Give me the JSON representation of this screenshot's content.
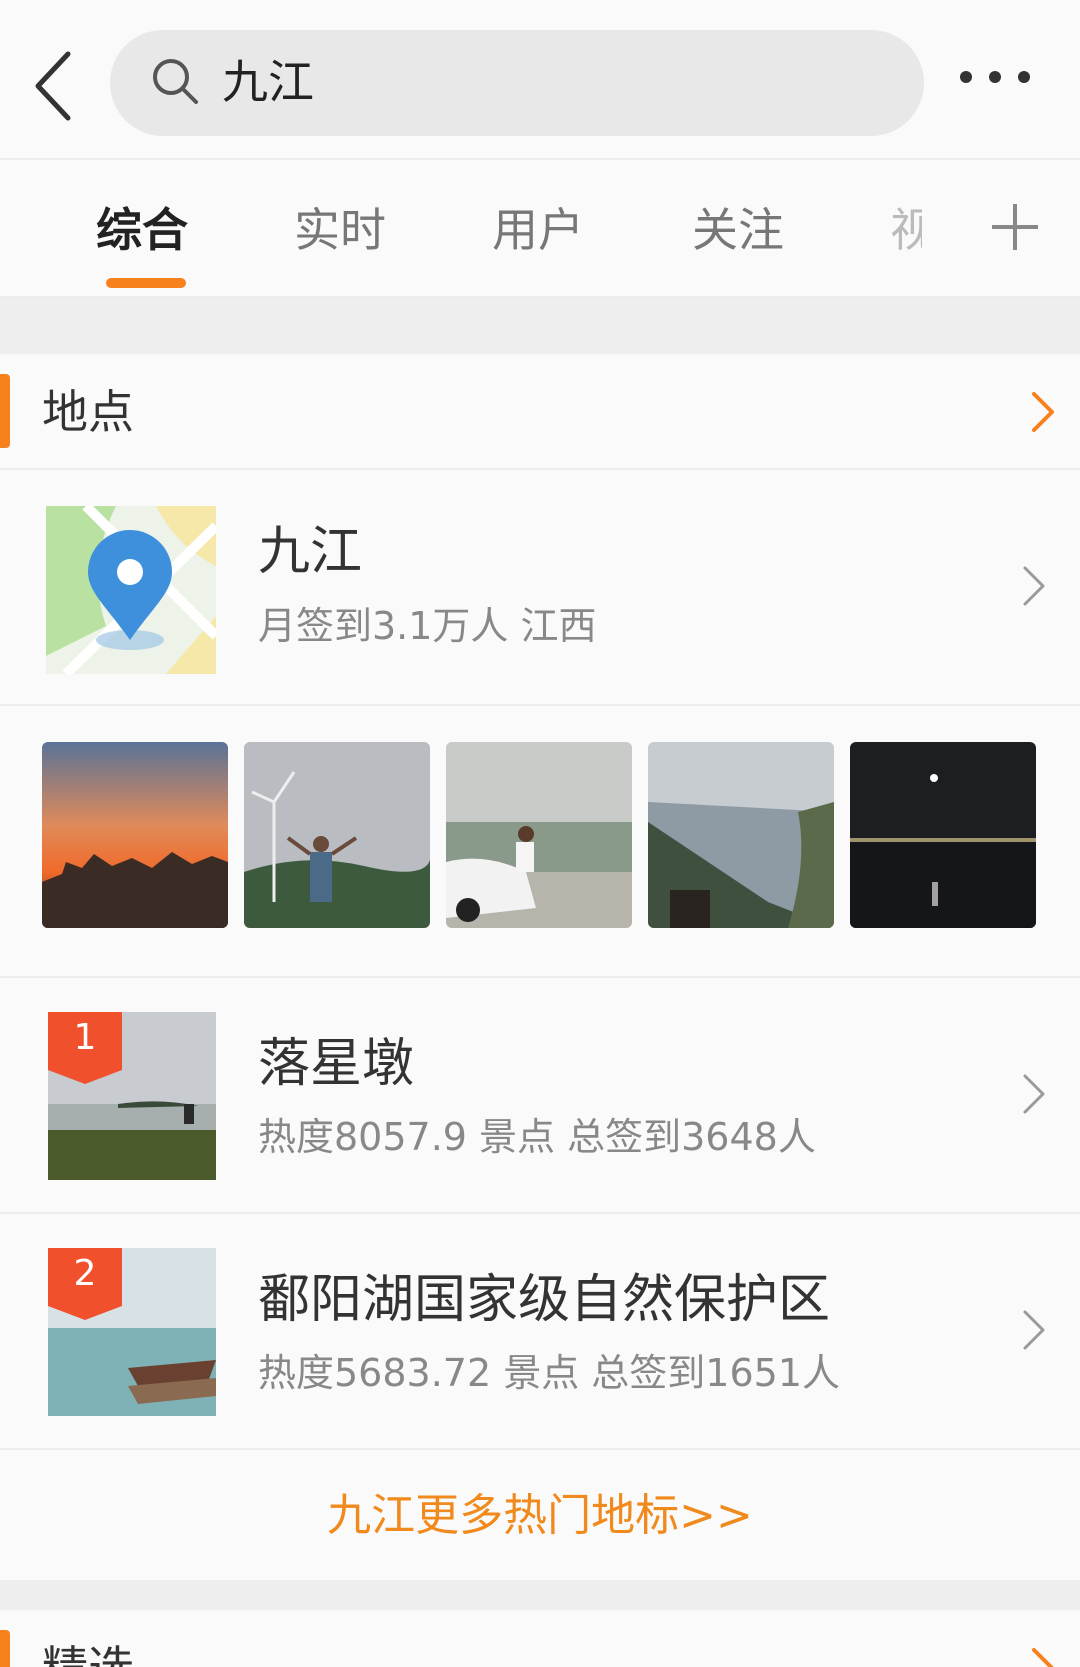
{
  "search": {
    "query": "九江"
  },
  "tabs": [
    "综合",
    "实时",
    "用户",
    "关注",
    "视"
  ],
  "section": {
    "title": "地点"
  },
  "place": {
    "name": "九江",
    "subtitle": "月签到3.1万人  江西"
  },
  "photos": [
    {
      "name": "sunset-city-photo"
    },
    {
      "name": "wind-turbine-photo"
    },
    {
      "name": "car-lake-photo"
    },
    {
      "name": "mountain-valley-photo"
    },
    {
      "name": "night-lake-photo"
    }
  ],
  "landmarks": [
    {
      "rank": "1",
      "name": "落星墩",
      "subtitle": "热度8057.9  景点  总签到3648人"
    },
    {
      "rank": "2",
      "name": "鄱阳湖国家级自然保护区",
      "subtitle": "热度5683.72  景点  总签到1651人"
    }
  ],
  "more_link": "九江更多热门地标>>",
  "section2": {
    "title": "精选"
  },
  "colors": {
    "accent": "#f7811d",
    "badge": "#f0502c",
    "link": "#f08a1c"
  }
}
